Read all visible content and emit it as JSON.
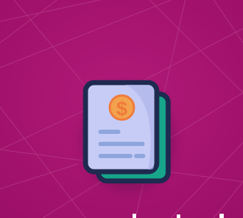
{
  "scene": {
    "background_color": "#9b0f68",
    "background_accent_color": "#b11a78",
    "line_color": "#c04a90",
    "icon": {
      "name": "invoice-documents-icon",
      "symbol": "$",
      "outline_color": "#1e2a4f",
      "front_page_color": "#c7ccf6",
      "front_page_shade_color": "#aeb4ea",
      "back_page_color": "#17a58b",
      "back_page_shadow_color": "#0f6f66",
      "coin_color": "#f3a24e",
      "coin_ring_color": "#f07a3a",
      "text_line_color": "#8ea6dd"
    }
  }
}
